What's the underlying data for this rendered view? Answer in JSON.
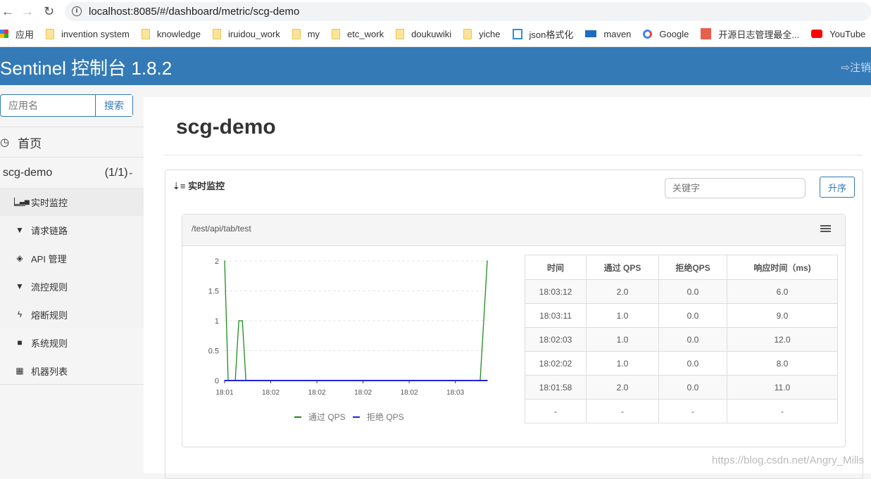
{
  "browser": {
    "url": "localhost:8085/#/dashboard/metric/scg-demo",
    "bookmarks": [
      {
        "label": "应用",
        "icon": "apps-icon"
      },
      {
        "label": "invention system",
        "icon": "folder-icon"
      },
      {
        "label": "knowledge",
        "icon": "folder-icon"
      },
      {
        "label": "iruidou_work",
        "icon": "folder-icon"
      },
      {
        "label": "my",
        "icon": "folder-icon"
      },
      {
        "label": "etc_work",
        "icon": "folder-icon"
      },
      {
        "label": "doukuwiki",
        "icon": "folder-icon"
      },
      {
        "label": "yiche",
        "icon": "folder-icon"
      },
      {
        "label": "json格式化",
        "icon": "bejson-icon"
      },
      {
        "label": "maven",
        "icon": "maven-icon"
      },
      {
        "label": "Google",
        "icon": "google-icon"
      },
      {
        "label": "开源日志管理最全...",
        "icon": "jianshu-icon"
      },
      {
        "label": "YouTube",
        "icon": "youtube-icon"
      }
    ]
  },
  "header": {
    "brand": "Sentinel 控制台 1.8.2",
    "logout": "注销"
  },
  "sidebar": {
    "search_placeholder": "应用名",
    "search_button": "搜索",
    "home": "首页",
    "app": {
      "name": "scg-demo",
      "count": "(1/1)"
    },
    "items": [
      {
        "label": "实时监控",
        "icon": "bar-chart-icon"
      },
      {
        "label": "请求链路",
        "icon": "filter-icon"
      },
      {
        "label": "API 管理",
        "icon": "tags-icon"
      },
      {
        "label": "流控规则",
        "icon": "filter-icon"
      },
      {
        "label": "熔断规则",
        "icon": "flash-icon"
      },
      {
        "label": "系统规则",
        "icon": "lock-icon"
      },
      {
        "label": "机器列表",
        "icon": "th-list-icon"
      }
    ]
  },
  "main": {
    "title": "scg-demo",
    "section_title": "实时监控",
    "keyword_placeholder": "关键字",
    "sort_button": "升序",
    "resource": "/test/api/tab/test",
    "table": {
      "headers": [
        "时间",
        "通过 QPS",
        "拒绝QPS",
        "响应时间（ms)"
      ],
      "rows": [
        [
          "18:03:12",
          "2.0",
          "0.0",
          "6.0"
        ],
        [
          "18:03:11",
          "1.0",
          "0.0",
          "9.0"
        ],
        [
          "18:02:03",
          "1.0",
          "0.0",
          "12.0"
        ],
        [
          "18:02:02",
          "1.0",
          "0.0",
          "8.0"
        ],
        [
          "18:01:58",
          "2.0",
          "0.0",
          "11.0"
        ],
        [
          "-",
          "-",
          "-",
          "-"
        ]
      ]
    }
  },
  "chart_data": {
    "type": "line",
    "x": [
      "18:01:58",
      "18:01:59",
      "18:02:01",
      "18:02:02",
      "18:02:03",
      "18:02:04",
      "18:03:10",
      "18:03:12"
    ],
    "series": [
      {
        "name": "通过 QPS",
        "color": "#1e8c1e",
        "values": [
          2,
          0,
          0,
          1,
          1,
          0,
          0,
          2
        ]
      },
      {
        "name": "拒绝 QPS",
        "color": "#2222dd",
        "values": [
          0,
          0,
          0,
          0,
          0,
          0,
          0,
          0
        ]
      }
    ],
    "yticks": [
      "0",
      "0.5",
      "1",
      "1.5",
      "2"
    ],
    "xticks": [
      "18:01",
      "18:02",
      "18:02",
      "18:02",
      "18:02",
      "18:03"
    ],
    "ylim": [
      0,
      2
    ],
    "grid": true,
    "legend": "bottom"
  },
  "watermark": "https://blog.csdn.net/Angry_Mills"
}
